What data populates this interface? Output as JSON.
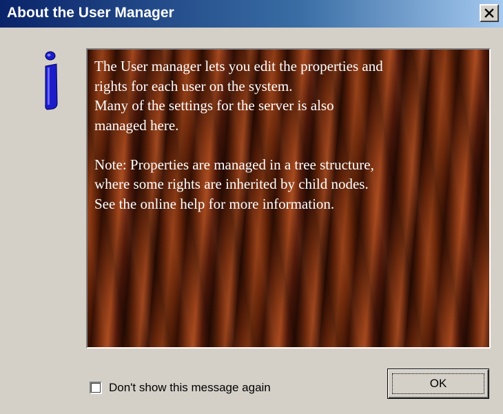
{
  "window": {
    "title": "About the User Manager",
    "close_icon": "close-icon"
  },
  "icon": {
    "name": "info-icon",
    "color": "#0000ee"
  },
  "message": {
    "lines": [
      "The User manager lets you edit the properties and",
      "rights for each user on the system.",
      "Many of the settings for the server is also",
      "managed here.",
      "",
      "Note: Properties are managed in a tree structure,",
      "where some rights are inherited by child nodes.",
      "See the online help for more information."
    ]
  },
  "footer": {
    "checkbox_label": "Don't show this message again",
    "checkbox_checked": false,
    "ok_label": "OK"
  }
}
